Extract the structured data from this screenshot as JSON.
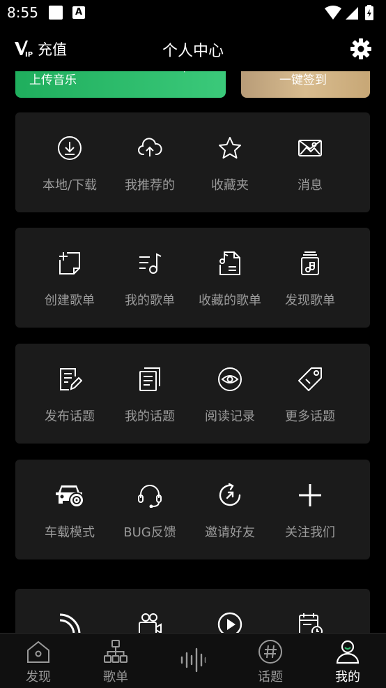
{
  "status": {
    "time": "8:55",
    "notification_letter": "A"
  },
  "header": {
    "vip_label": "充值",
    "title": "个人中心"
  },
  "banners": {
    "upload_music": "上传音乐",
    "sign_in": "一键签到"
  },
  "sections": [
    {
      "items": [
        {
          "label": "本地/下载",
          "icon": "download-icon"
        },
        {
          "label": "我推荐的",
          "icon": "cloud-upload-icon"
        },
        {
          "label": "收藏夹",
          "icon": "star-icon"
        },
        {
          "label": "消息",
          "icon": "image-message-icon"
        }
      ]
    },
    {
      "items": [
        {
          "label": "创建歌单",
          "icon": "add-note-icon"
        },
        {
          "label": "我的歌单",
          "icon": "playlist-icon"
        },
        {
          "label": "收藏的歌单",
          "icon": "saved-playlist-icon"
        },
        {
          "label": "发现歌单",
          "icon": "discover-playlist-icon"
        }
      ]
    },
    {
      "items": [
        {
          "label": "发布话题",
          "icon": "edit-document-icon"
        },
        {
          "label": "我的话题",
          "icon": "documents-icon"
        },
        {
          "label": "阅读记录",
          "icon": "eye-icon"
        },
        {
          "label": "更多话题",
          "icon": "tag-icon"
        }
      ]
    },
    {
      "items": [
        {
          "label": "车载模式",
          "icon": "car-music-icon"
        },
        {
          "label": "BUG反馈",
          "icon": "headset-icon"
        },
        {
          "label": "邀请好友",
          "icon": "refresh-arrow-icon"
        },
        {
          "label": "关注我们",
          "icon": "plus-icon"
        }
      ]
    }
  ],
  "partial_section_icons": [
    "rss-icon",
    "video-camera-icon",
    "play-circle-icon",
    "calendar-clock-icon"
  ],
  "tabs": [
    {
      "label": "发现",
      "icon": "home-icon"
    },
    {
      "label": "歌单",
      "icon": "hierarchy-icon"
    },
    {
      "label": "",
      "icon": "soundwave-icon"
    },
    {
      "label": "话题",
      "icon": "hashtag-icon"
    },
    {
      "label": "我的",
      "icon": "user-icon"
    }
  ],
  "colors": {
    "background": "#000000",
    "card": "#1b1b1b",
    "label_gray": "#9a9a9a",
    "green": "#2dbd6e",
    "gold": "#c9ab7f"
  }
}
